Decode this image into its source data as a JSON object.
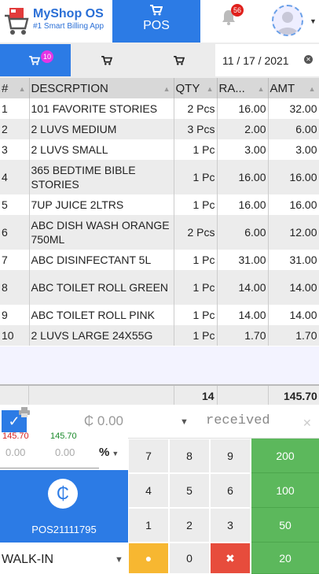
{
  "brand": {
    "name": "MyShop OS",
    "tagline": "#1 Smart Billing App"
  },
  "nav": {
    "pos_label": "POS",
    "notification_count": "56",
    "cart_count": "10"
  },
  "date": "11 / 17 / 2021",
  "grid": {
    "headers": [
      "#",
      "DESCRPTION",
      "QTY",
      "RA...",
      "AMT"
    ],
    "rows": [
      {
        "no": "1",
        "desc": "101 FAVORITE STORIES",
        "qty": "2 Pcs",
        "rate": "16.00",
        "amt": "32.00"
      },
      {
        "no": "2",
        "desc": "2 LUVS MEDIUM",
        "qty": "3 Pcs",
        "rate": "2.00",
        "amt": "6.00"
      },
      {
        "no": "3",
        "desc": "2 LUVS SMALL",
        "qty": "1 Pc",
        "rate": "3.00",
        "amt": "3.00"
      },
      {
        "no": "4",
        "desc": "365 BEDTIME BIBLE STORIES",
        "qty": "1 Pc",
        "rate": "16.00",
        "amt": "16.00"
      },
      {
        "no": "5",
        "desc": "7UP JUICE 2LTRS",
        "qty": "1 Pc",
        "rate": "16.00",
        "amt": "16.00"
      },
      {
        "no": "6",
        "desc": "ABC DISH WASH ORANGE 750ML",
        "qty": "2 Pcs",
        "rate": "6.00",
        "amt": "12.00"
      },
      {
        "no": "7",
        "desc": "ABC DISINFECTANT 5L",
        "qty": "1 Pc",
        "rate": "31.00",
        "amt": "31.00"
      },
      {
        "no": "8",
        "desc": "ABC TOILET ROLL GREEN",
        "qty": "1 Pc",
        "rate": "14.00",
        "amt": "14.00"
      },
      {
        "no": "9",
        "desc": "ABC TOILET ROLL PINK",
        "qty": "1 Pc",
        "rate": "14.00",
        "amt": "14.00"
      },
      {
        "no": "10",
        "desc": "2 LUVS LARGE 24X55G",
        "qty": "1 Pc",
        "rate": "1.70",
        "amt": "1.70"
      }
    ],
    "total_qty": "14",
    "total_amt": "145.70"
  },
  "payment": {
    "amount": "₵ 0.00",
    "red_value": "145.70",
    "green_value": "145.70",
    "input1": "0.00",
    "input2": "0.00",
    "discount_unit": "%",
    "received_placeholder": "received",
    "currency_symbol": "₵",
    "bill_no": "POS21111795",
    "customer": "WALK-IN"
  },
  "keypad": {
    "keys": [
      "7",
      "8",
      "9",
      "4",
      "5",
      "6",
      "1",
      "2",
      "3",
      "●",
      "0",
      "✖"
    ],
    "quick": [
      "200",
      "100",
      "50",
      "20"
    ]
  },
  "colors": {
    "accent": "#2c7be5",
    "green": "#5cb85c",
    "yellow": "#f7b731",
    "red": "#e74c3c"
  }
}
